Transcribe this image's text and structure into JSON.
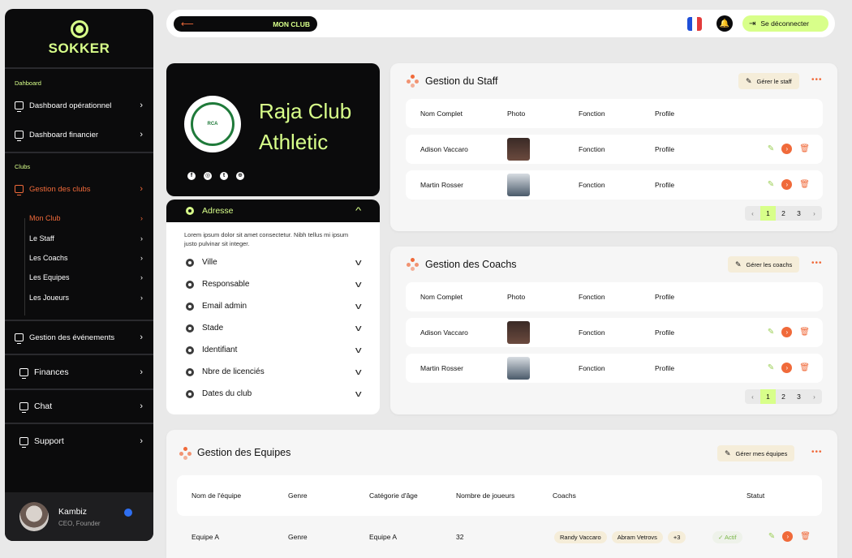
{
  "sidebar": {
    "brand": "SOKKER",
    "sections": {
      "dashboard": "Dahboard",
      "clubs": "Clubs"
    },
    "items": {
      "dash_ops": "Dashboard opérationnel",
      "dash_fin": "Dashboard financier",
      "clubs": "Gestion des clubs",
      "events": "Gestion des événements",
      "finances": "Finances",
      "chat": "Chat",
      "support": "Support"
    },
    "subitems": [
      "Mon Club",
      "Le Staff",
      "Les Coachs",
      "Les Equipes",
      "Les Joueurs"
    ],
    "user": {
      "name": "Kambiz",
      "role": "CEO, Founder"
    }
  },
  "topbar": {
    "back_arrow": "⟵",
    "page_title": "MON CLUB",
    "logout_label": "Se déconnecter",
    "flag_colors": [
      "#1f4fd8",
      "#ffffff",
      "#e23b3b"
    ]
  },
  "club": {
    "name_line1": "Raja Club",
    "name_line2": "Athletic",
    "crest_text": "RAJA CLUB ATHLETIC",
    "socials": [
      "facebook-icon",
      "instagram-icon",
      "twitter-icon",
      "web-icon"
    ]
  },
  "info": {
    "header": "Adresse",
    "description": "Lorem ipsum dolor sit amet consectetur. Nibh tellus mi ipsum justo pulvinar sit integer.",
    "fields": [
      "Ville",
      "Responsable",
      "Email admin",
      "Stade",
      "Identifiant",
      "Nbre de licenciés",
      "Dates du club"
    ]
  },
  "staff": {
    "title": "Gestion du Staff",
    "manage_label": "Gérer le staff",
    "columns": [
      "Nom Complet",
      "Photo",
      "Fonction",
      "Profile"
    ],
    "rows": [
      {
        "name": "Adison Vaccaro",
        "function": "Fonction",
        "profile": "Profile"
      },
      {
        "name": "Martin Rosser",
        "function": "Fonction",
        "profile": "Profile"
      }
    ],
    "pages": [
      "1",
      "2",
      "3"
    ]
  },
  "coachs": {
    "title": "Gestion des Coachs",
    "manage_label": "Gérer les coachs",
    "columns": [
      "Nom Complet",
      "Photo",
      "Fonction",
      "Profile"
    ],
    "rows": [
      {
        "name": "Adison Vaccaro",
        "function": "Fonction",
        "profile": "Profile"
      },
      {
        "name": "Martin Rosser",
        "function": "Fonction",
        "profile": "Profile"
      }
    ],
    "pages": [
      "1",
      "2",
      "3"
    ]
  },
  "teams": {
    "title": "Gestion des Equipes",
    "manage_label": "Gérer mes équipes",
    "columns": [
      "Nom de l'équipe",
      "Genre",
      "Catégorie d'âge",
      "Nombre de joueurs",
      "Coachs",
      "Statut"
    ],
    "rows": [
      {
        "name": "Equipe A",
        "genre": "Genre",
        "category": "Equipe A",
        "players": "32",
        "coachs": [
          "Randy Vaccaro",
          "Abram Vetrovs"
        ],
        "more": "+3",
        "status": "Actif"
      }
    ]
  },
  "accent": "#f06a3a",
  "lime": "#d8ff8a"
}
